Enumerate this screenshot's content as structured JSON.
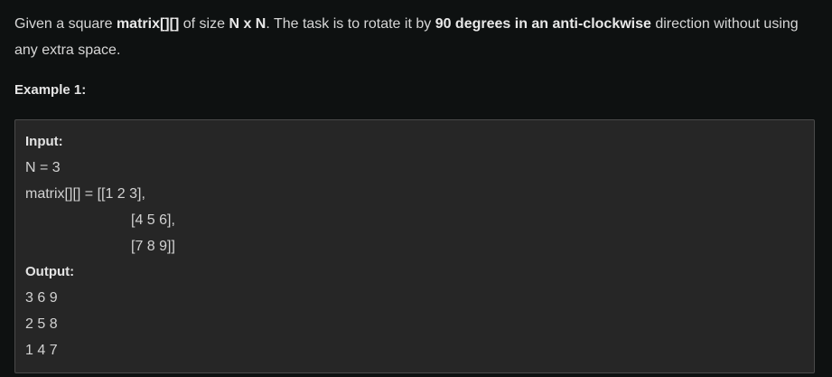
{
  "problem": {
    "t1": "Given a square ",
    "b1": "matrix[][]",
    "t2": " of size ",
    "b2": "N x N",
    "t3": ". The task is to rotate it by ",
    "b3": "90 degrees in an anti-clockwise",
    "t4": " direction without using any extra space."
  },
  "example": {
    "heading": "Example 1:",
    "input_label": "Input:",
    "input_lines": [
      "N = 3",
      "matrix[][] = [[1 2 3],",
      "[4 5 6],",
      "[7 8 9]]"
    ],
    "output_label": "Output:",
    "output_lines": [
      "3 6 9",
      "2 5 8",
      "1 4 7"
    ]
  }
}
